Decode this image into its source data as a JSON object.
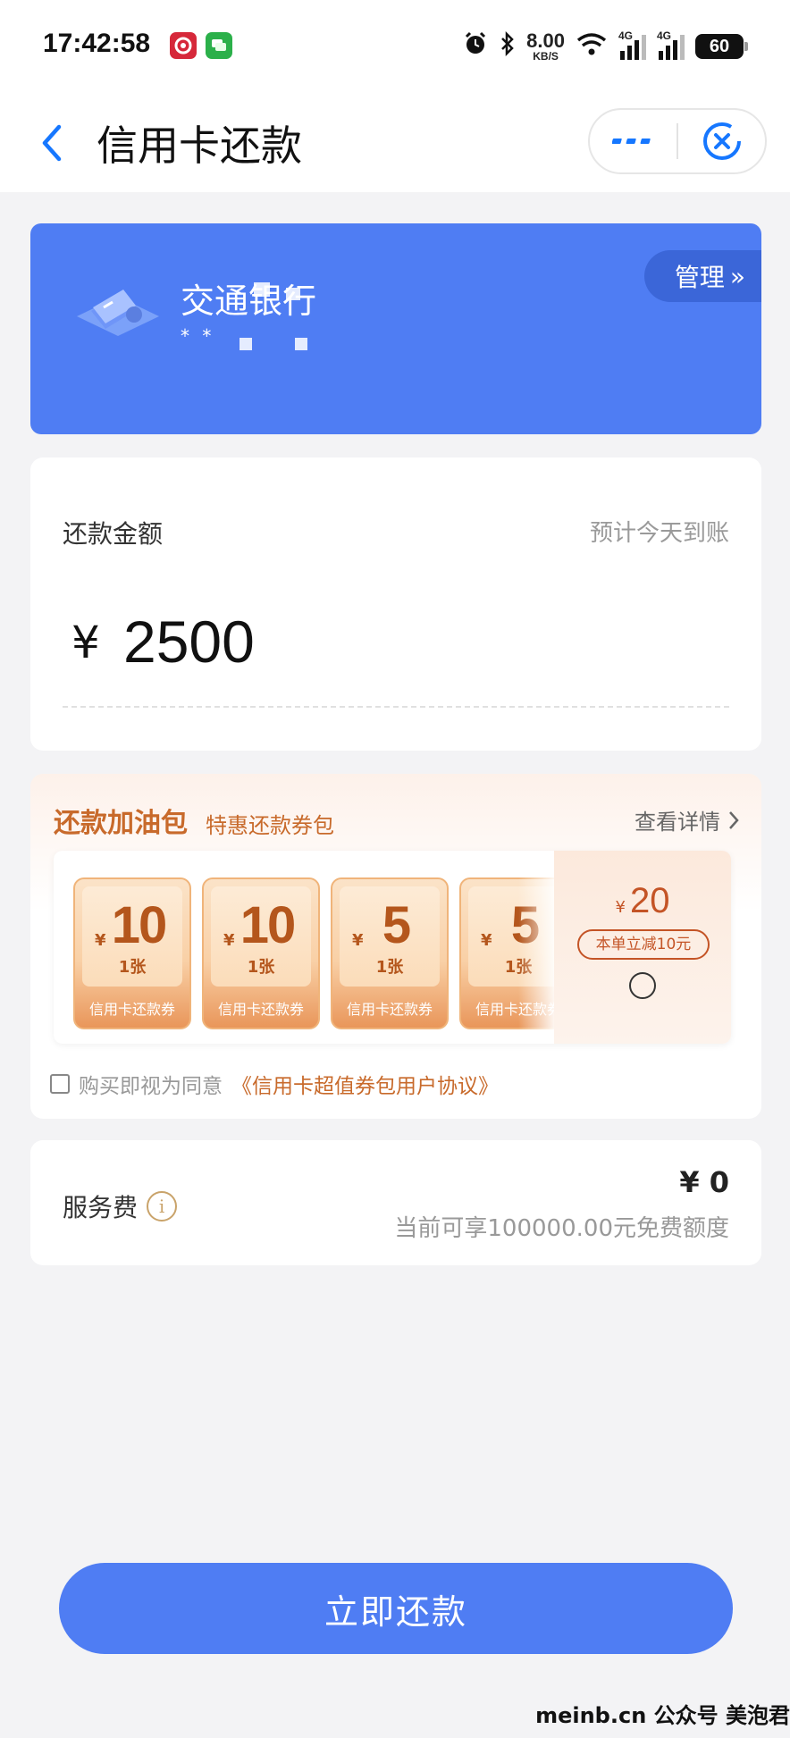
{
  "status_bar": {
    "time": "17:42:58",
    "net_speed_value": "8.00",
    "net_speed_unit": "KB/S",
    "signal_1_label": "4G",
    "signal_2_label": "4G",
    "battery": "60"
  },
  "nav": {
    "title": "信用卡还款"
  },
  "bank_card": {
    "bank_name": "交通银行",
    "card_number_masked": "* *  ",
    "manage_label": "管理",
    "manage_arrow": "»"
  },
  "amount": {
    "label": "还款金额",
    "arrival_note": "预计今天到账",
    "currency": "¥",
    "value": "2500"
  },
  "promo": {
    "title": "还款加油包",
    "subtitle": "特惠还款券包",
    "detail_label": "查看详情",
    "coupons": [
      {
        "yen": "¥",
        "value": "10",
        "qty": "1张",
        "tag": "信用卡还款券"
      },
      {
        "yen": "¥",
        "value": "10",
        "qty": "1张",
        "tag": "信用卡还款券"
      },
      {
        "yen": "¥",
        "value": "5",
        "qty": "1张",
        "tag": "信用卡还款券"
      },
      {
        "yen": "¥",
        "value": "5",
        "qty": "1张",
        "tag": "信用卡还款券"
      }
    ],
    "bundle_currency": "¥",
    "bundle_price": "20",
    "bundle_badge": "本单立减10元",
    "agree_text": "购买即视为同意",
    "agree_link": "《信用卡超值券包用户协议》"
  },
  "fee": {
    "label": "服务费",
    "value": "¥ 0",
    "note": "当前可享100000.00元免费额度"
  },
  "pay_button_label": "立即还款",
  "watermark": "meinb.cn  公众号 美泡君",
  "colors": {
    "primary_blue": "#4f7df3",
    "promo_orange": "#c86a2b",
    "background": "#f3f3f5"
  }
}
